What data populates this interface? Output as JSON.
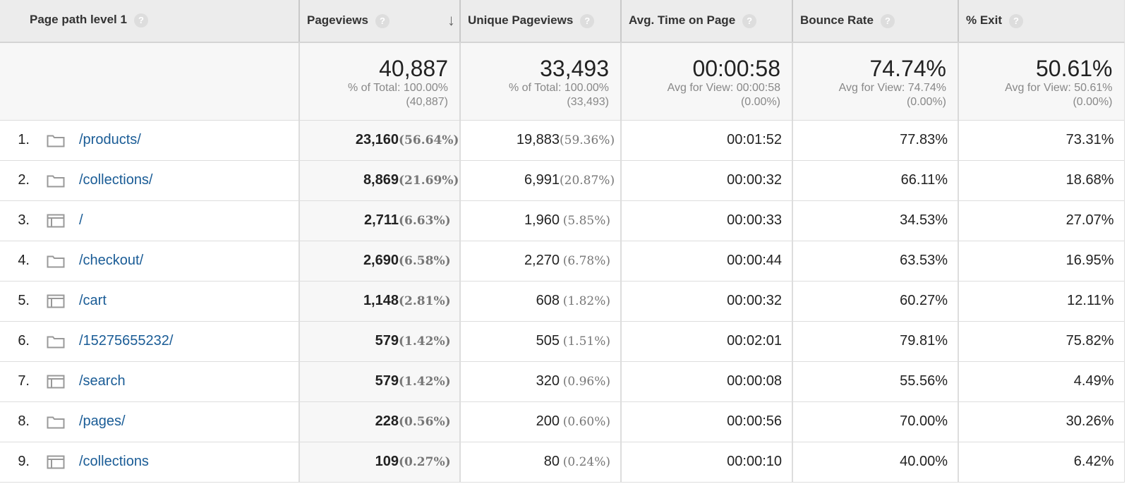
{
  "headers": {
    "dimension": "Page path level 1",
    "pageviews": "Pageviews",
    "unique": "Unique Pageviews",
    "avg_time": "Avg. Time on Page",
    "bounce": "Bounce Rate",
    "exit": "% Exit",
    "help": "?",
    "sort_icon": "arrow-down-icon"
  },
  "totals": {
    "pageviews": "40,887",
    "pageviews_sub1": "% of Total: 100.00%",
    "pageviews_sub2": "(40,887)",
    "unique": "33,493",
    "unique_sub1": "% of Total: 100.00%",
    "unique_sub2": "(33,493)",
    "avg_time": "00:00:58",
    "avg_time_sub1": "Avg for View: 00:00:58",
    "avg_time_sub2": "(0.00%)",
    "bounce": "74.74%",
    "bounce_sub1": "Avg for View: 74.74%",
    "bounce_sub2": "(0.00%)",
    "exit": "50.61%",
    "exit_sub1": "Avg for View: 50.61%",
    "exit_sub2": "(0.00%)"
  },
  "rows": [
    {
      "index": "1.",
      "icon": "folder-icon",
      "path": "/products/",
      "pageviews": "23,160",
      "pageviews_pct": "(56.64%)",
      "unique": "19,883",
      "unique_pct": "(59.36%)",
      "avg_time": "00:01:52",
      "bounce": "77.83%",
      "exit": "73.31%"
    },
    {
      "index": "2.",
      "icon": "folder-icon",
      "path": "/collections/",
      "pageviews": "8,869",
      "pageviews_pct": "(21.69%)",
      "unique": "6,991",
      "unique_pct": "(20.87%)",
      "avg_time": "00:00:32",
      "bounce": "66.11%",
      "exit": "18.68%"
    },
    {
      "index": "3.",
      "icon": "page-icon",
      "path": "/",
      "pageviews": "2,711",
      "pageviews_pct": "(6.63%)",
      "unique": "1,960",
      "unique_pct": "(5.85%)",
      "avg_time": "00:00:33",
      "bounce": "34.53%",
      "exit": "27.07%"
    },
    {
      "index": "4.",
      "icon": "folder-icon",
      "path": "/checkout/",
      "pageviews": "2,690",
      "pageviews_pct": "(6.58%)",
      "unique": "2,270",
      "unique_pct": "(6.78%)",
      "avg_time": "00:00:44",
      "bounce": "63.53%",
      "exit": "16.95%"
    },
    {
      "index": "5.",
      "icon": "page-icon",
      "path": "/cart",
      "pageviews": "1,148",
      "pageviews_pct": "(2.81%)",
      "unique": "608",
      "unique_pct": "(1.82%)",
      "avg_time": "00:00:32",
      "bounce": "60.27%",
      "exit": "12.11%"
    },
    {
      "index": "6.",
      "icon": "folder-icon",
      "path": "/15275655232/",
      "pageviews": "579",
      "pageviews_pct": "(1.42%)",
      "unique": "505",
      "unique_pct": "(1.51%)",
      "avg_time": "00:02:01",
      "bounce": "79.81%",
      "exit": "75.82%"
    },
    {
      "index": "7.",
      "icon": "page-icon",
      "path": "/search",
      "pageviews": "579",
      "pageviews_pct": "(1.42%)",
      "unique": "320",
      "unique_pct": "(0.96%)",
      "avg_time": "00:00:08",
      "bounce": "55.56%",
      "exit": "4.49%"
    },
    {
      "index": "8.",
      "icon": "folder-icon",
      "path": "/pages/",
      "pageviews": "228",
      "pageviews_pct": "(0.56%)",
      "unique": "200",
      "unique_pct": "(0.60%)",
      "avg_time": "00:00:56",
      "bounce": "70.00%",
      "exit": "30.26%"
    },
    {
      "index": "9.",
      "icon": "page-icon",
      "path": "/collections",
      "pageviews": "109",
      "pageviews_pct": "(0.27%)",
      "unique": "80",
      "unique_pct": "(0.24%)",
      "avg_time": "00:00:10",
      "bounce": "40.00%",
      "exit": "6.42%"
    }
  ]
}
